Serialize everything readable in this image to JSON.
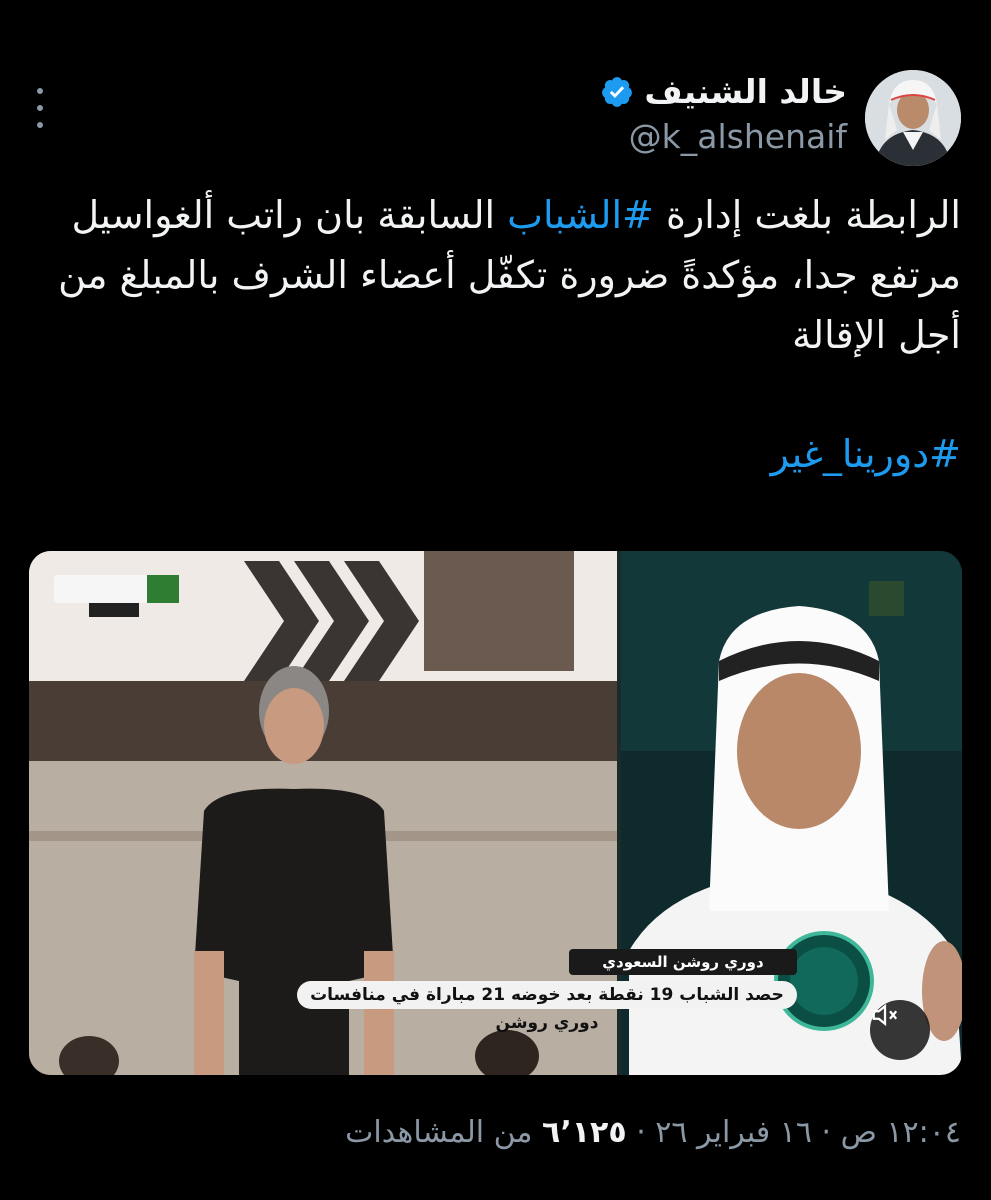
{
  "author": {
    "display_name": "خالد الشنيف",
    "handle": "@k_alshenaif",
    "verified_icon": "verified-badge-icon",
    "verified_color": "#1d9bf0"
  },
  "tweet": {
    "line1_a": "الرابطة بلغت إدارة ",
    "line1_hashtag": "#الشباب",
    "line1_b": " السابقة بان راتب ألغواسيل",
    "line2": "مرتفع جدا، مؤكدةً ضرورة تكفّل أعضاء الشرف بالمبلغ من",
    "line3": "أجل الإقالة",
    "hashtag_line": "#دورينا_غير"
  },
  "media": {
    "ticker_top": "دوري روشن السعودي",
    "ticker_main": "حصد الشباب 19 نقطة بعد خوضه 21 مباراة في منافسات دوري روشن",
    "mute_icon": "speaker-muted-icon"
  },
  "meta": {
    "time": "١٢:٠٤ ص",
    "dot1": " · ",
    "date": "١٦ فبراير ٢٦",
    "dot2": " · ",
    "views_count": "٦٬١٢٥",
    "views_label": " من المشاهدات"
  },
  "colors": {
    "background": "#000000",
    "text": "#e7e9ea",
    "muted": "#8b98a5",
    "accent": "#1d9bf0"
  }
}
